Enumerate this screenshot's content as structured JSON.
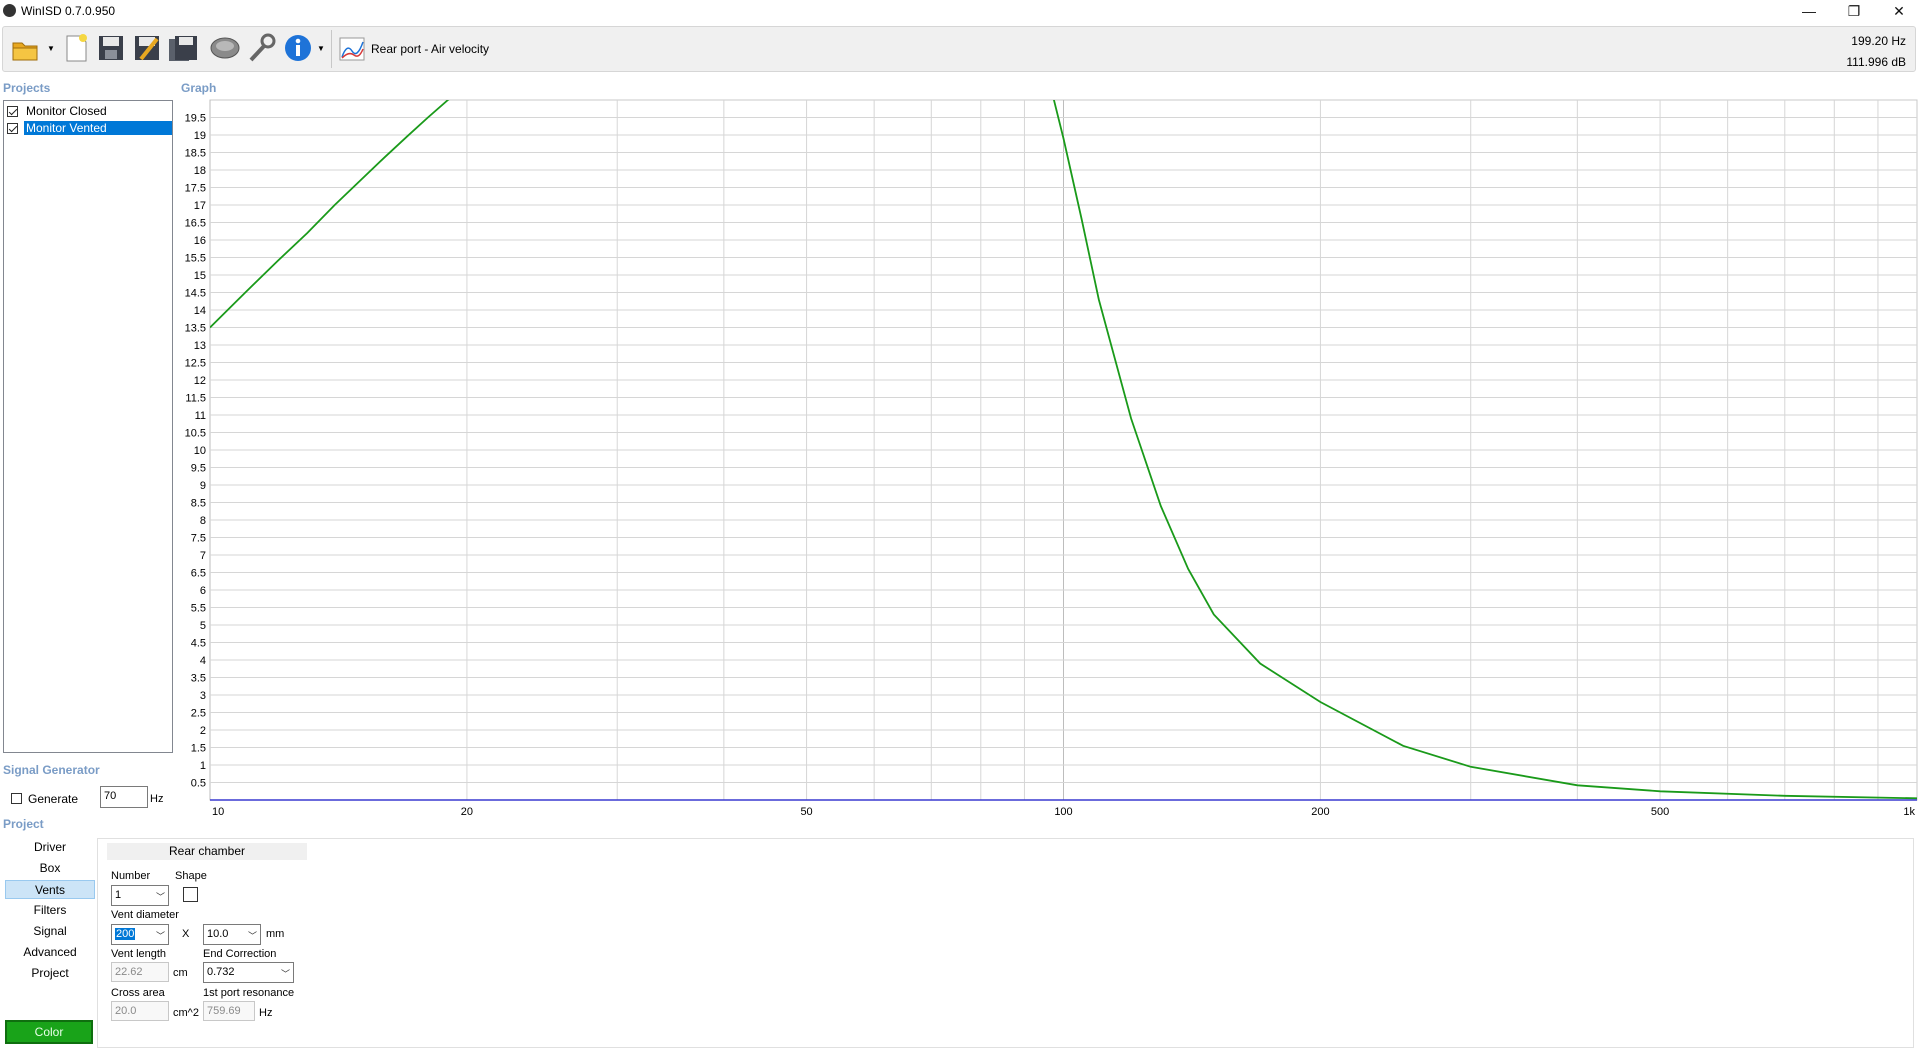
{
  "window": {
    "title": "WinISD 0.7.0.950",
    "minimize": "—",
    "restore": "❐",
    "close": "✕"
  },
  "toolbar": {
    "graph_mode": "Rear port - Air velocity",
    "readout_freq": "199.20 Hz",
    "readout_db": "111.996 dB",
    "buttons": [
      "open-icon",
      "new-icon",
      "save-icon",
      "save-as-icon",
      "save-all-icon",
      "driver-db-icon",
      "tools-icon",
      "info-icon",
      "graph-icon"
    ]
  },
  "projects": {
    "title": "Projects",
    "items": [
      {
        "label": "Monitor Closed",
        "checked": true,
        "selected": false
      },
      {
        "label": "Monitor Vented",
        "checked": true,
        "selected": true
      }
    ]
  },
  "graph": {
    "title": "Graph"
  },
  "signal_generator": {
    "title": "Signal Generator",
    "generate_label": "Generate",
    "frequency": "70",
    "unit": "Hz"
  },
  "project": {
    "title": "Project",
    "nav": [
      "Driver",
      "Box",
      "Vents",
      "Filters",
      "Signal",
      "Advanced",
      "Project"
    ],
    "active_nav": "Vents",
    "color_button": "Color",
    "color": "#19a319",
    "tab": "Rear chamber",
    "number_label": "Number",
    "number_value": "1",
    "shape_label": "Shape",
    "vent_diameter_label": "Vent diameter",
    "vent_diameter_value": "200",
    "x_label": "X",
    "vent_diameter2_value": "10.0",
    "mm_unit": "mm",
    "vent_length_label": "Vent length",
    "vent_length_value": "22.62",
    "cm_unit": "cm",
    "end_correction_label": "End Correction",
    "end_correction_value": "0.732",
    "cross_area_label": "Cross area",
    "cross_area_value": "20.0",
    "cm2_unit": "cm^2",
    "port_resonance_label": "1st port resonance",
    "port_resonance_value": "759.69",
    "hz_unit": "Hz"
  },
  "chart_data": {
    "type": "line",
    "title": "",
    "xlabel": "",
    "ylabel": "",
    "x_scale": "log",
    "xlim": [
      10,
      1000
    ],
    "ylim": [
      0,
      20
    ],
    "grid": true,
    "x_ticks": [
      {
        "value": 10,
        "label": "10"
      },
      {
        "value": 20,
        "label": "20"
      },
      {
        "value": 50,
        "label": "50"
      },
      {
        "value": 100,
        "label": "100"
      },
      {
        "value": 200,
        "label": "200"
      },
      {
        "value": 500,
        "label": "500"
      },
      {
        "value": 1000,
        "label": "1k"
      }
    ],
    "y_ticks": [
      "0.5",
      "1",
      "1.5",
      "2",
      "2.5",
      "3",
      "3.5",
      "4",
      "4.5",
      "5",
      "5.5",
      "6",
      "6.5",
      "7",
      "7.5",
      "8",
      "8.5",
      "9",
      "9.5",
      "10",
      "10.5",
      "11",
      "11.5",
      "12",
      "12.5",
      "13",
      "13.5",
      "14",
      "14.5",
      "15",
      "15.5",
      "16",
      "16.5",
      "17",
      "17.5",
      "18",
      "18.5",
      "19",
      "19.5"
    ],
    "series": [
      {
        "color": "#1a9a1a",
        "x": [
          10,
          11,
          12,
          13,
          14,
          15,
          16,
          17,
          18,
          19,
          20,
          20.8
        ],
        "y": [
          13.5,
          14.5,
          15.4,
          16.2,
          17.0,
          17.7,
          18.35,
          18.95,
          19.5,
          20.0,
          20.4,
          20.7
        ]
      },
      {
        "color": "#1a9a1a",
        "x": [
          97,
          100,
          105,
          110,
          120,
          130,
          140,
          150,
          170,
          200,
          250,
          300,
          400,
          500,
          700,
          1000
        ],
        "y": [
          20.2,
          18.9,
          16.6,
          14.3,
          10.9,
          8.4,
          6.6,
          5.3,
          3.9,
          2.8,
          1.55,
          0.95,
          0.42,
          0.25,
          0.12,
          0.05
        ]
      },
      {
        "color": "#3a3ad0",
        "x": [
          10,
          1000
        ],
        "y": [
          0,
          0
        ]
      }
    ]
  }
}
